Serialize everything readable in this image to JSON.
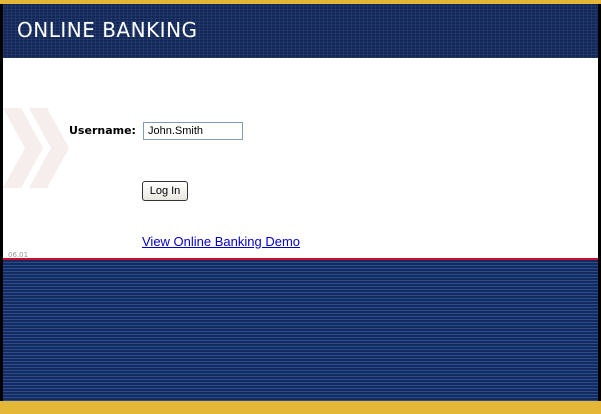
{
  "header": {
    "title": "ONLINE BANKING"
  },
  "login": {
    "username_label": "Username:",
    "username_value": "John.Smith",
    "login_button_label": "Log In",
    "demo_link": "View Online Banking Demo"
  },
  "footer": {
    "version": "06.01"
  },
  "colors": {
    "header_bg": "#12285a",
    "accent_gold": "#e5b737",
    "accent_red": "#c8102e",
    "link_blue": "#0000cc"
  },
  "icons": [
    "double-chevron-watermark-icon"
  ]
}
